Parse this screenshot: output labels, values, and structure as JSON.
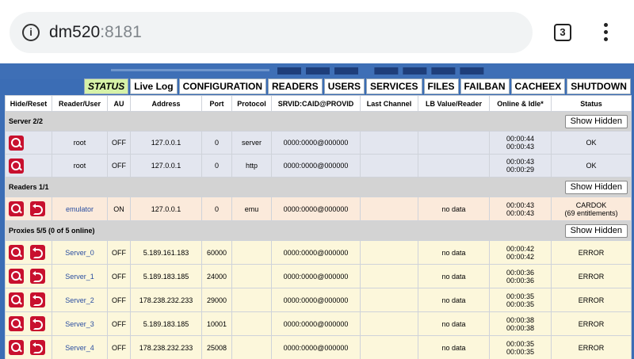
{
  "browser": {
    "host": "dm520",
    "port": ":8181",
    "tab_count": "3"
  },
  "nav": [
    {
      "label": "STATUS"
    },
    {
      "label": "Live Log"
    },
    {
      "label": "CONFIGURATION"
    },
    {
      "label": "READERS"
    },
    {
      "label": "USERS"
    },
    {
      "label": "SERVICES"
    },
    {
      "label": "FILES"
    },
    {
      "label": "FAILBAN"
    },
    {
      "label": "CACHEEX"
    },
    {
      "label": "SHUTDOWN"
    }
  ],
  "columns": [
    "Hide/Reset",
    "Reader/User",
    "AU",
    "Address",
    "Port",
    "Protocol",
    "SRVID:CAID@PROVID",
    "Last Channel",
    "LB Value/Reader",
    "Online & Idle*",
    "Status"
  ],
  "show_hidden_label": "Show Hidden",
  "servers": {
    "title": "Server 2/2",
    "rows": [
      {
        "name": "root",
        "au": "OFF",
        "address": "127.0.0.1",
        "port": "0",
        "protocol": "server",
        "srvid": "0000:0000@000000",
        "last_channel": "",
        "lb": "",
        "online": "00:00:44",
        "idle": "00:00:43",
        "status": "OK"
      },
      {
        "name": "root",
        "au": "OFF",
        "address": "127.0.0.1",
        "port": "0",
        "protocol": "http",
        "srvid": "0000:0000@000000",
        "last_channel": "",
        "lb": "",
        "online": "00:00:43",
        "idle": "00:00:29",
        "status": "OK"
      }
    ]
  },
  "readers": {
    "title": "Readers 1/1",
    "rows": [
      {
        "name": "emulator",
        "au": "ON",
        "address": "127.0.0.1",
        "port": "0",
        "protocol": "emu",
        "srvid": "0000:0000@000000",
        "last_channel": "",
        "lb": "no data",
        "online": "00:00:43",
        "idle": "00:00:43",
        "status": "CARDOK",
        "status2": "(69 entitlements)"
      }
    ]
  },
  "proxies": {
    "title": "Proxies 5/5 (0 of 5 online)",
    "rows": [
      {
        "name": "Server_0",
        "au": "OFF",
        "address": "5.189.161.183",
        "port": "60000",
        "protocol": "",
        "srvid": "0000:0000@000000",
        "last_channel": "",
        "lb": "no data",
        "online": "00:00:42",
        "idle": "00:00:42",
        "status": "ERROR"
      },
      {
        "name": "Server_1",
        "au": "OFF",
        "address": "5.189.183.185",
        "port": "24000",
        "protocol": "",
        "srvid": "0000:0000@000000",
        "last_channel": "",
        "lb": "no data",
        "online": "00:00:36",
        "idle": "00:00:36",
        "status": "ERROR"
      },
      {
        "name": "Server_2",
        "au": "OFF",
        "address": "178.238.232.233",
        "port": "29000",
        "protocol": "",
        "srvid": "0000:0000@000000",
        "last_channel": "",
        "lb": "no data",
        "online": "00:00:35",
        "idle": "00:00:35",
        "status": "ERROR"
      },
      {
        "name": "Server_3",
        "au": "OFF",
        "address": "5.189.183.185",
        "port": "10001",
        "protocol": "",
        "srvid": "0000:0000@000000",
        "last_channel": "",
        "lb": "no data",
        "online": "00:00:38",
        "idle": "00:00:38",
        "status": "ERROR"
      },
      {
        "name": "Server_4",
        "au": "OFF",
        "address": "178.238.232.233",
        "port": "25008",
        "protocol": "",
        "srvid": "0000:0000@000000",
        "last_channel": "",
        "lb": "no data",
        "online": "00:00:35",
        "idle": "00:00:35",
        "status": "ERROR"
      }
    ]
  }
}
